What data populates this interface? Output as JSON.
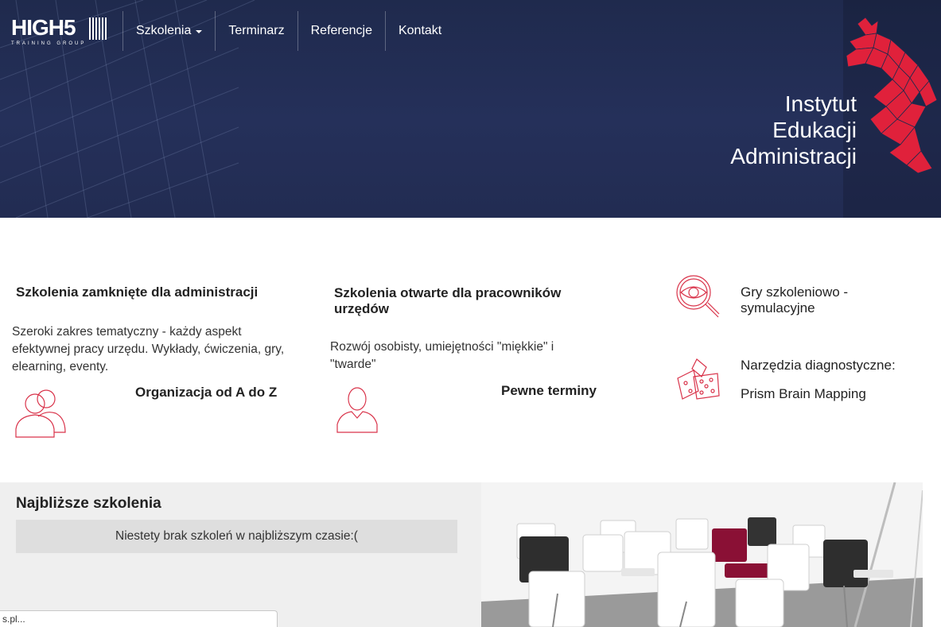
{
  "header": {
    "logo": {
      "main": "HIGH5",
      "sub": "TRAINING GROUP"
    },
    "nav": [
      {
        "label": "Szkolenia",
        "has_dropdown": true
      },
      {
        "label": "Terminarz"
      },
      {
        "label": "Referencje"
      },
      {
        "label": "Kontakt"
      }
    ],
    "title_lines": [
      "Instytut",
      "Edukacji",
      "Administracji"
    ]
  },
  "features": {
    "closed": {
      "title": "Szkolenia zamknięte dla administracji",
      "text": "Szeroki zakres tematyczny - każdy aspekt efektywnej pracy urzędu. Wykłady, ćwiczenia, gry, elearning, eventy."
    },
    "organization": {
      "title": "Organizacja od A do Z"
    },
    "open": {
      "title": "Szkolenia otwarte dla pracowników urzędów",
      "text": "Rozwój osobisty, umiejętności \"miękkie\" i \"twarde\""
    },
    "dates": {
      "title": "Pewne terminy"
    },
    "games": {
      "title": "Gry szkoleniowo - symulacyjne"
    },
    "diagnostic": {
      "title": "Narzędzia diagnostyczne:",
      "subtitle": "Prism Brain Mapping"
    }
  },
  "upcoming": {
    "title": "Najbliższe szkolenia",
    "notice": "Niestety brak szkoleń w najbliższym czasie:("
  },
  "status_bar": {
    "text": "s.pl..."
  },
  "colors": {
    "hero_bg": "#222c52",
    "accent": "#e0213b",
    "icon_red": "#d9334a",
    "panel_bg": "#efefef"
  },
  "icons": [
    "people-icon",
    "person-icon",
    "eye-magnifier-icon",
    "dice-icon",
    "griffin-logo-icon"
  ]
}
